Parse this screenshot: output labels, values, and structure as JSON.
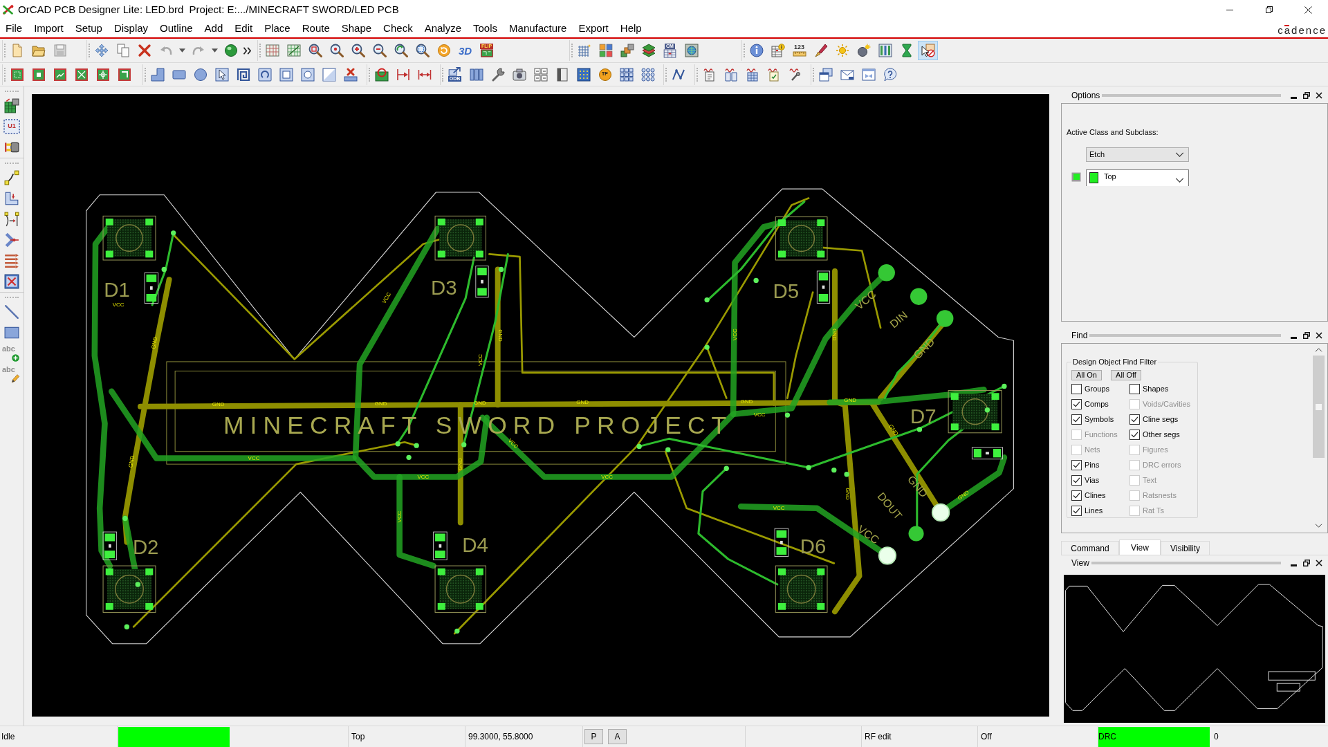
{
  "window": {
    "title": "OrCAD PCB Designer Lite: LED.brd  Project: E:.../MINECRAFT SWORD/LED PCB"
  },
  "menu": [
    "File",
    "Import",
    "Setup",
    "Display",
    "Outline",
    "Add",
    "Edit",
    "Place",
    "Route",
    "Shape",
    "Check",
    "Analyze",
    "Tools",
    "Manufacture",
    "Export",
    "Help"
  ],
  "brand": "cadence",
  "toolbar_texts": [
    "3D",
    "FLIP",
    "CM",
    "123",
    "ODB",
    "TP"
  ],
  "side_toolbar_texts": [
    "U1",
    "abc",
    "abc"
  ],
  "board": {
    "title": "MINECRAFT SWORD PROJECT",
    "designators": [
      "D1",
      "D3",
      "D5",
      "D7",
      "D2",
      "D4",
      "D6"
    ],
    "pin_labels": [
      "VCC",
      "DIN",
      "GND",
      "GND",
      "DOUT",
      "VCC"
    ],
    "net_labels": [
      "VCC",
      "VCC",
      "GND",
      "GND",
      "VCC",
      "GND",
      "VCC",
      "GND",
      "GND",
      "GND",
      "GND",
      "GND",
      "GND",
      "VCC",
      "GND",
      "VCC",
      "GND",
      "VCC",
      "GND",
      "VCC",
      "VCC",
      "GND",
      "GND",
      "VCC",
      "VCC"
    ]
  },
  "options": {
    "title": "Options",
    "label": "Active Class and Subclass:",
    "class": "Etch",
    "subclass": "Top"
  },
  "find": {
    "title": "Find",
    "group": "Design Object Find Filter",
    "buttons": [
      "All On",
      "All Off"
    ],
    "items": [
      {
        "label": "Groups",
        "checked": false,
        "disabled": false
      },
      {
        "label": "Shapes",
        "checked": false,
        "disabled": false
      },
      {
        "label": "Comps",
        "checked": true,
        "disabled": false
      },
      {
        "label": "Voids/Cavities",
        "checked": false,
        "disabled": true
      },
      {
        "label": "Symbols",
        "checked": true,
        "disabled": false
      },
      {
        "label": "Cline segs",
        "checked": true,
        "disabled": false
      },
      {
        "label": "Functions",
        "checked": false,
        "disabled": true
      },
      {
        "label": "Other segs",
        "checked": true,
        "disabled": false
      },
      {
        "label": "Nets",
        "checked": false,
        "disabled": true
      },
      {
        "label": "Figures",
        "checked": false,
        "disabled": true
      },
      {
        "label": "Pins",
        "checked": true,
        "disabled": false
      },
      {
        "label": "DRC errors",
        "checked": false,
        "disabled": true
      },
      {
        "label": "Vias",
        "checked": true,
        "disabled": false
      },
      {
        "label": "Text",
        "checked": false,
        "disabled": true
      },
      {
        "label": "Clines",
        "checked": true,
        "disabled": false
      },
      {
        "label": "Ratsnests",
        "checked": false,
        "disabled": true
      },
      {
        "label": "Lines",
        "checked": true,
        "disabled": false
      },
      {
        "label": "Rat Ts",
        "checked": false,
        "disabled": true
      }
    ]
  },
  "panel_tabs": [
    {
      "label": "Command",
      "selected": false
    },
    {
      "label": "View",
      "selected": true
    },
    {
      "label": "Visibility",
      "selected": false
    }
  ],
  "view": {
    "title": "View"
  },
  "status_bar": {
    "state": "Idle",
    "layer": "Top",
    "coordinates": "99.3000, 55.8000",
    "buttons": [
      "P",
      "A"
    ],
    "mode": "RF edit",
    "setting": "Off",
    "drc": "DRC",
    "drc_count": "0"
  }
}
